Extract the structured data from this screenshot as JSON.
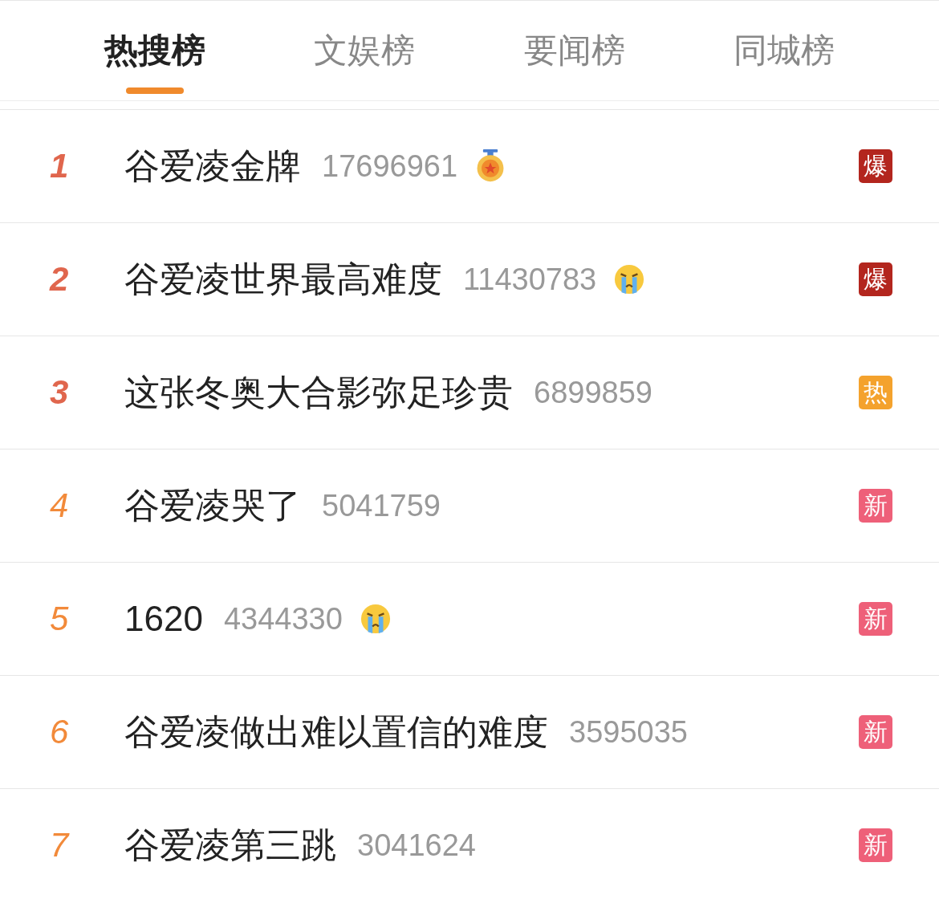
{
  "tabs": [
    {
      "label": "热搜榜",
      "selected": true
    },
    {
      "label": "文娱榜",
      "selected": false
    },
    {
      "label": "要闻榜",
      "selected": false
    },
    {
      "label": "同城榜",
      "selected": false
    }
  ],
  "rows": [
    {
      "rank": "1",
      "top": true,
      "title": "谷爱凌金牌",
      "count": "17696961",
      "kind": "medal",
      "badge": {
        "kind": "boom",
        "text": "爆"
      }
    },
    {
      "rank": "2",
      "top": true,
      "title": "谷爱凌世界最高难度",
      "count": "11430783",
      "kind": "crying",
      "badge": {
        "kind": "boom",
        "text": "爆"
      }
    },
    {
      "rank": "3",
      "top": true,
      "title": "这张冬奥大合影弥足珍贵",
      "count": "6899859",
      "badge": {
        "kind": "hot",
        "text": "热"
      }
    },
    {
      "rank": "4",
      "top": false,
      "title": "谷爱凌哭了",
      "count": "5041759",
      "badge": {
        "kind": "new",
        "text": "新"
      }
    },
    {
      "rank": "5",
      "top": false,
      "title": "1620",
      "count": "4344330",
      "kind": "crying",
      "badge": {
        "kind": "new",
        "text": "新"
      }
    },
    {
      "rank": "6",
      "top": false,
      "title": "谷爱凌做出难以置信的难度",
      "count": "3595035",
      "badge": {
        "kind": "new",
        "text": "新"
      }
    },
    {
      "rank": "7",
      "top": false,
      "title": "谷爱凌第三跳",
      "count": "3041624",
      "badge": {
        "kind": "new",
        "text": "新"
      }
    }
  ]
}
